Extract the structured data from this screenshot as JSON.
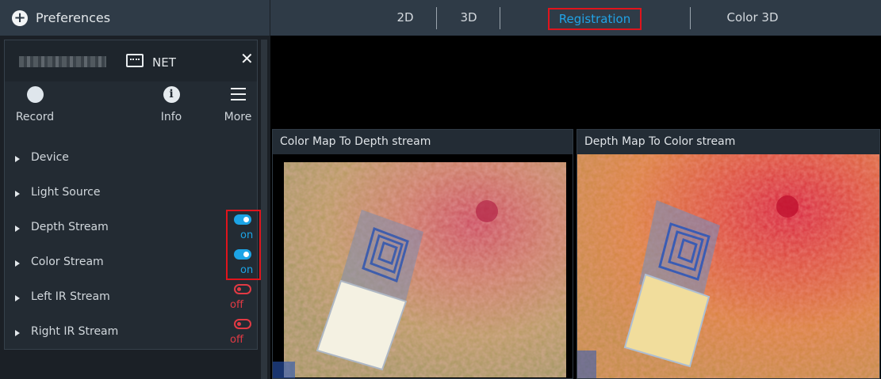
{
  "header": {
    "preferences_label": "Preferences",
    "tabs": [
      {
        "label": "2D"
      },
      {
        "label": "3D"
      },
      {
        "label": "Registration"
      },
      {
        "label": "Color 3D"
      }
    ],
    "active_tab": "Registration"
  },
  "device": {
    "connection_label": "NET",
    "toolbar": {
      "record_label": "Record",
      "info_label": "Info",
      "more_label": "More"
    },
    "streams": [
      {
        "label": "Device",
        "toggle": null
      },
      {
        "label": "Light Source",
        "toggle": null
      },
      {
        "label": "Depth Stream",
        "toggle": "on"
      },
      {
        "label": "Color Stream",
        "toggle": "on"
      },
      {
        "label": "Left IR Stream",
        "toggle": "off"
      },
      {
        "label": "Right IR Stream",
        "toggle": "off"
      }
    ]
  },
  "views": [
    {
      "title": "Color Map To Depth stream"
    },
    {
      "title": "Depth Map To Color stream"
    }
  ],
  "colors": {
    "accent": "#1ca4e6",
    "off": "#e23a44",
    "highlight": "#e0141c"
  }
}
